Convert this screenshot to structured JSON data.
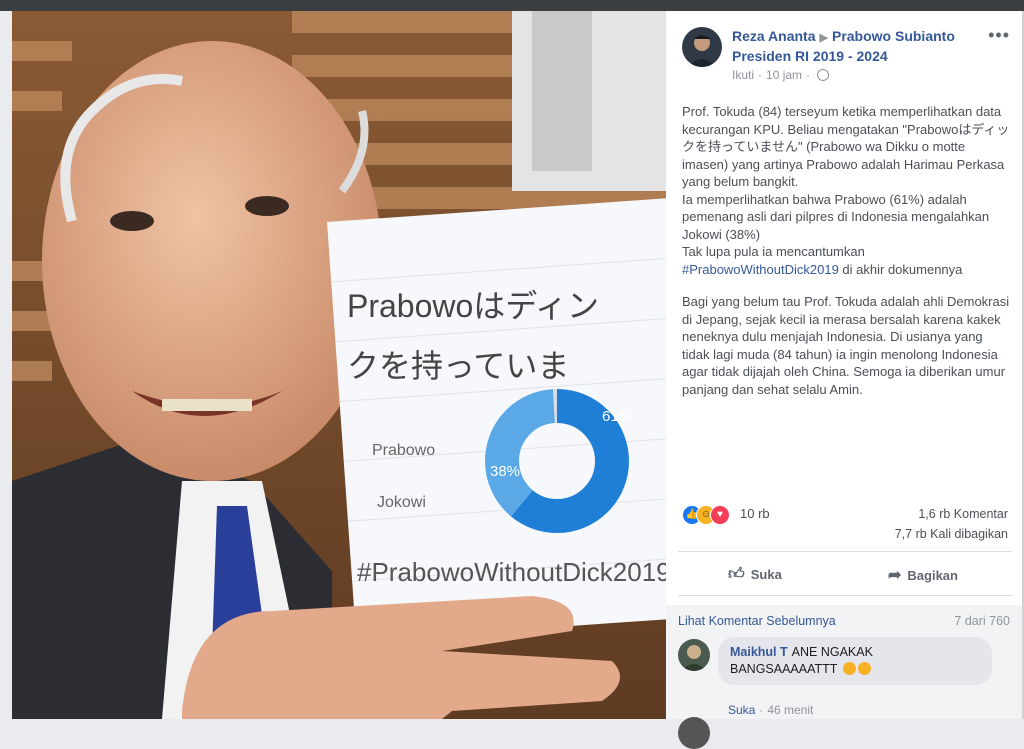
{
  "post": {
    "author": "Reza Ananta",
    "target": "Prabowo Subianto Presiden RI 2019 - 2024",
    "follow_label": "Ikuti",
    "time": "10 jam",
    "paragraphs": [
      "Prof. Tokuda (84) terseyum ketika memperlihatkan data kecurangan KPU. Beliau mengatakan \"Prabowoはディックを持っていません\" (Prabowo wa Dikku o motte imasen) yang artinya Prabowo adalah Harimau Perkasa yang belum bangkit.\nIa memperlihatkan bahwa Prabowo (61%) adalah pemenang asli dari pilpres di Indonesia mengalahkan Jokowi (38%)\nTak lupa pula ia mencantumkan",
      "Bagi yang belum tau Prof. Tokuda adalah ahli Demokrasi di Jepang, sejak kecil ia merasa bersalah karena kakek neneknya dulu menjajah Indonesia. Di usianya yang tidak lagi muda (84 tahun) ia ingin menolong Indonesia agar tidak dijajah oleh China. Semoga ia diberikan umur panjang dan sehat selalu Amin."
    ],
    "hashtag": "#PrabowoWithoutDick2019",
    "hashtag_suffix": " di akhir dokumennya"
  },
  "photo": {
    "note_line1": "Prabowoはディン",
    "note_line2": "クを持っていま",
    "label_prabowo": "Prabowo",
    "label_jokowi": "Jokowi",
    "pct_prabowo": "61%",
    "pct_jokowi": "38%",
    "hashtag": "#PrabowoWithoutDick2019",
    "donut_values": [
      61,
      38,
      1
    ],
    "colors": {
      "prabowo": "#1f7fd6",
      "jokowi": "#5aa9e6",
      "other": "#d9dde3"
    }
  },
  "stats": {
    "reactions": "10 rb",
    "comments": "1,6 rb Komentar",
    "shares": "7,7 rb Kali dibagikan"
  },
  "actions": {
    "like": "Suka",
    "share": "Bagikan"
  },
  "comments": {
    "see_previous": "Lihat Komentar Sebelumnya",
    "count": "7 dari 760",
    "items": [
      {
        "author": "Maikhul T",
        "text": "ANE NGAKAK BANGSAAAAATTT",
        "like_label": "Suka",
        "time": "46 menit"
      }
    ]
  },
  "colors": {
    "link": "#365899",
    "text": "#4b4f56",
    "muted": "#90949c"
  }
}
